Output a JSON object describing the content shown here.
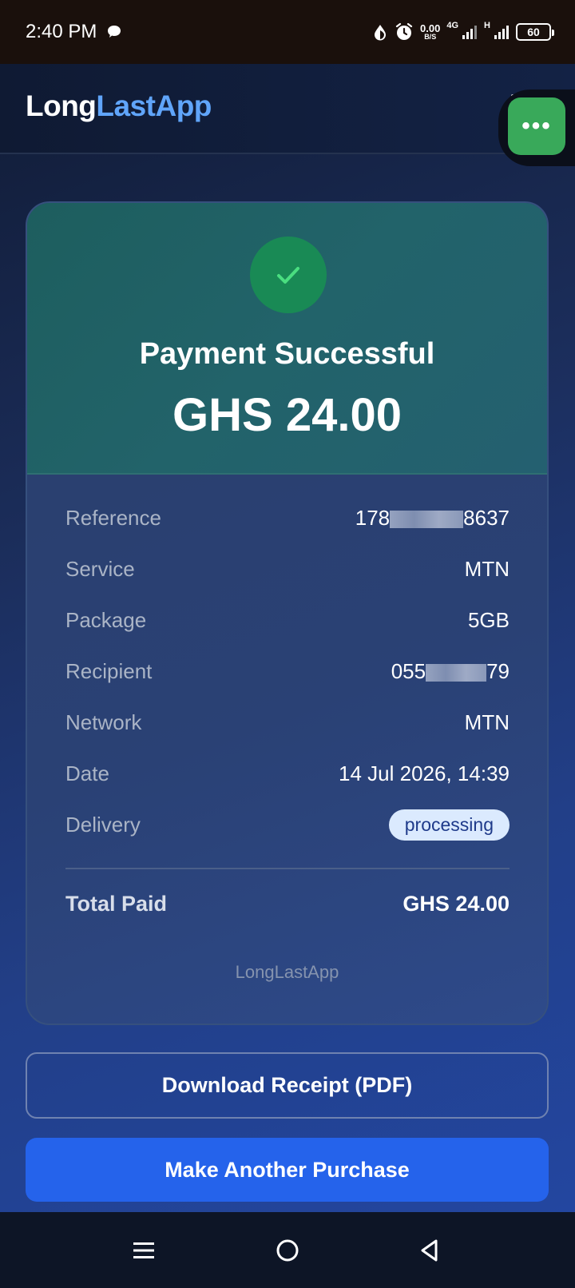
{
  "status_bar": {
    "time": "2:40 PM",
    "net_speed_value": "0.00",
    "net_speed_unit": "B/S",
    "sim1_label": "4G",
    "sim2_label": "H",
    "battery": "60"
  },
  "header": {
    "logo_part1": "Long",
    "logo_part2": "LastApp",
    "float_button_label": "•••"
  },
  "receipt": {
    "title": "Payment Successful",
    "amount": "GHS 24.00",
    "rows": [
      {
        "label": "Reference",
        "value_start": "178",
        "value_end": "8637"
      },
      {
        "label": "Service",
        "value": "MTN"
      },
      {
        "label": "Package",
        "value": "5GB"
      },
      {
        "label": "Recipient",
        "value_start": "055",
        "value_end": "79"
      },
      {
        "label": "Network",
        "value": "MTN"
      },
      {
        "label": "Date",
        "value": "14 Jul 2026, 14:39"
      },
      {
        "label": "Delivery",
        "value": "processing"
      }
    ],
    "total_label": "Total Paid",
    "total_value": "GHS 24.00",
    "footer": "LongLastApp"
  },
  "actions": {
    "download_label": "Download Receipt (PDF)",
    "purchase_label": "Make Another Purchase"
  },
  "colors": {
    "accent": "#2563eb",
    "logo_blue": "#60a5fa",
    "success": "#198a55",
    "badge_bg": "#dbeafe"
  }
}
